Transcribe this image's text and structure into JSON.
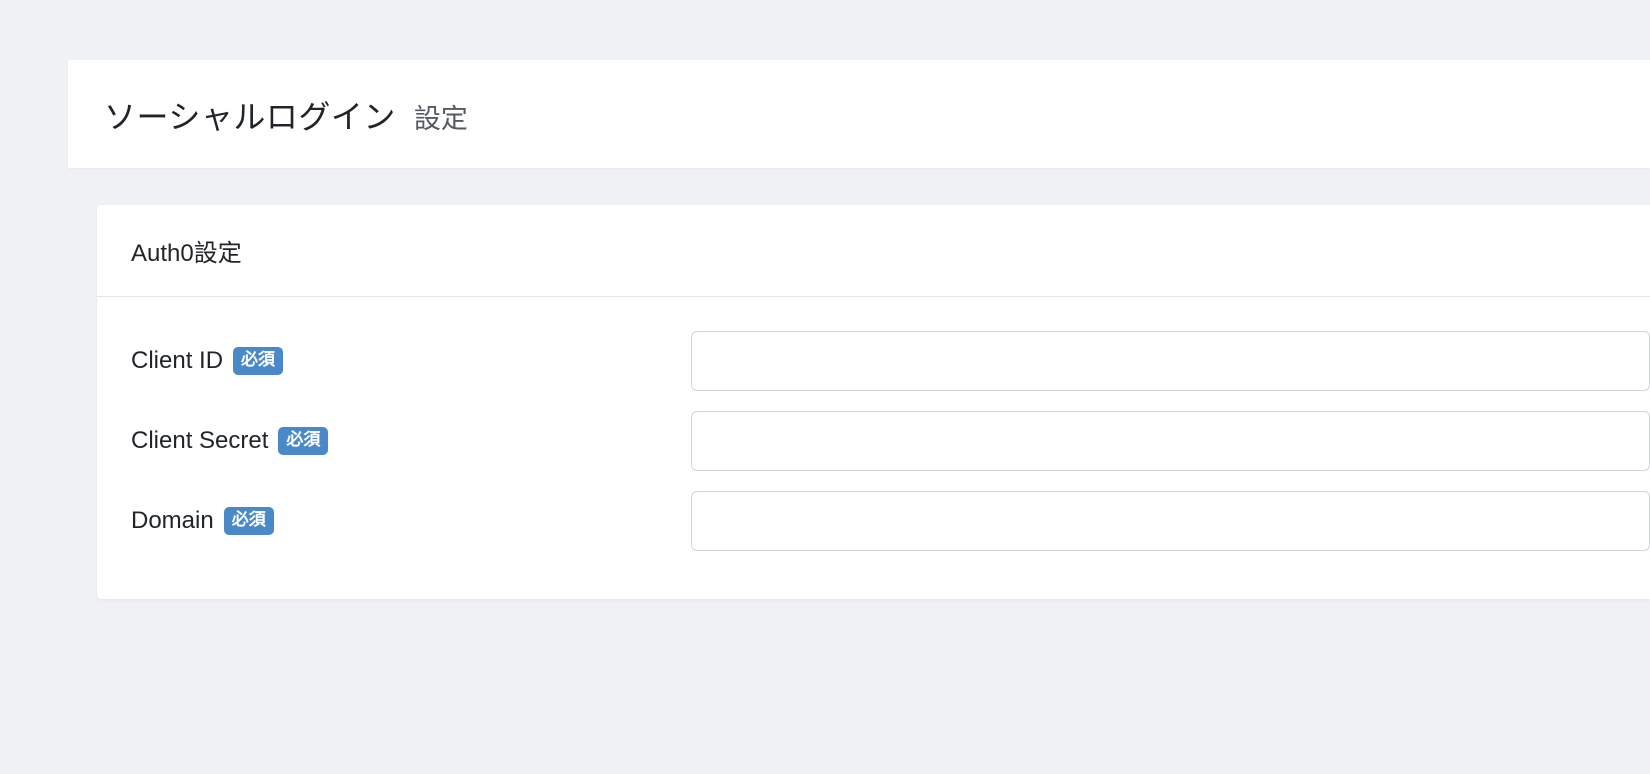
{
  "header": {
    "title_main": "ソーシャルログイン",
    "title_sub": "設定"
  },
  "form": {
    "section_title": "Auth0設定",
    "required_badge": "必須",
    "fields": {
      "client_id": {
        "label": "Client ID",
        "value": ""
      },
      "client_secret": {
        "label": "Client Secret",
        "value": ""
      },
      "domain": {
        "label": "Domain",
        "value": ""
      }
    }
  }
}
